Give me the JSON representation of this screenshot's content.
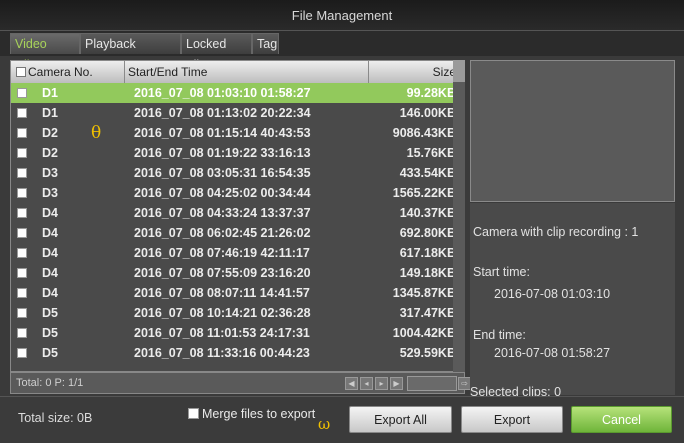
{
  "window": {
    "title": "File Management"
  },
  "tabs": [
    {
      "label": "Video Clips",
      "active": true
    },
    {
      "label": "Playback Capture",
      "active": false
    },
    {
      "label": "Locked File",
      "active": false
    },
    {
      "label": "Tag",
      "active": false
    }
  ],
  "table": {
    "columns": {
      "camera": "Camera No.",
      "time": "Start/End Time",
      "size": "Size"
    },
    "rows": [
      {
        "camera": "D1",
        "time": "2016_07_08 01:03:10 01:58:27",
        "size": "99.28KB",
        "selected": true
      },
      {
        "camera": "D1",
        "time": "2016_07_08 01:13:02 20:22:34",
        "size": "146.00KB"
      },
      {
        "camera": "D2",
        "time": "2016_07_08 01:15:14 40:43:53",
        "size": "9086.43KB"
      },
      {
        "camera": "D2",
        "time": "2016_07_08 01:19:22 33:16:13",
        "size": "15.76KB"
      },
      {
        "camera": "D3",
        "time": "2016_07_08 03:05:31 16:54:35",
        "size": "433.54KB"
      },
      {
        "camera": "D3",
        "time": "2016_07_08 04:25:02 00:34:44",
        "size": "1565.22KB"
      },
      {
        "camera": "D4",
        "time": "2016_07_08 04:33:24 13:37:37",
        "size": "140.37KB"
      },
      {
        "camera": "D4",
        "time": "2016_07_08 06:02:45 21:26:02",
        "size": "692.80KB"
      },
      {
        "camera": "D4",
        "time": "2016_07_08 07:46:19 42:11:17",
        "size": "617.18KB"
      },
      {
        "camera": "D4",
        "time": "2016_07_08 07:55:09 23:16:20",
        "size": "149.18KB"
      },
      {
        "camera": "D4",
        "time": "2016_07_08 08:07:11 14:41:57",
        "size": "1345.87KB"
      },
      {
        "camera": "D5",
        "time": "2016_07_08 10:14:21 02:36:28",
        "size": "317.47KB"
      },
      {
        "camera": "D5",
        "time": "2016_07_08 11:01:53 24:17:31",
        "size": "1004.42KB"
      },
      {
        "camera": "D5",
        "time": "2016_07_08 11:33:16 00:44:23",
        "size": "529.59KB"
      }
    ],
    "annotation_theta": "θ"
  },
  "status": {
    "total": "Total: 0  P: 1/1"
  },
  "info": {
    "camera_with_clip": "Camera with clip recording : 1",
    "start_label": "Start time:",
    "start_value": "2016-07-08 01:03:10",
    "end_label": "End time:",
    "end_value": "2016-07-08 01:58:27",
    "selected": "Selected clips: 0"
  },
  "footer": {
    "total_size": "Total size: 0B",
    "merge_label": "Merge files to export",
    "annotation_omega": "ω",
    "export_all": "Export All",
    "export": "Export",
    "cancel": "Cancel"
  },
  "colors": {
    "selected_row": "#92c95c",
    "active_tab": "#a8d35a",
    "cancel_button": "#7cc040"
  }
}
